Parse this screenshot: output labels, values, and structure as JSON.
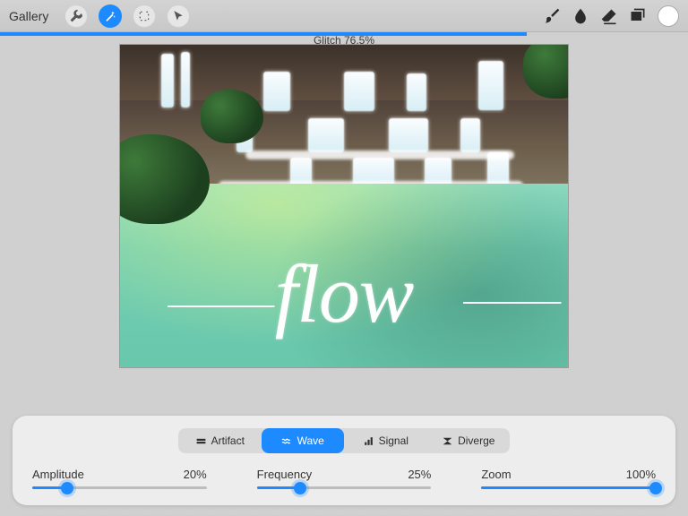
{
  "accent": "#1d8bff",
  "header": {
    "gallery_label": "Gallery"
  },
  "filter": {
    "name": "Glitch",
    "percent": 76.5,
    "label": "Glitch 76.5%"
  },
  "canvas_text": "flow",
  "modes": {
    "items": [
      {
        "id": "artifact",
        "label": "Artifact"
      },
      {
        "id": "wave",
        "label": "Wave"
      },
      {
        "id": "signal",
        "label": "Signal"
      },
      {
        "id": "diverge",
        "label": "Diverge"
      }
    ],
    "active": "wave"
  },
  "sliders": {
    "amplitude": {
      "label": "Amplitude",
      "value_text": "20%",
      "value": 20
    },
    "frequency": {
      "label": "Frequency",
      "value_text": "25%",
      "value": 25
    },
    "zoom": {
      "label": "Zoom",
      "value_text": "100%",
      "value": 100
    }
  }
}
